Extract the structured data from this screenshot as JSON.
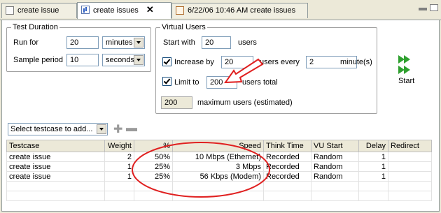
{
  "tabs": [
    {
      "label": "create issue",
      "icon": "testcase-icon"
    },
    {
      "label": "create issues",
      "icon": "schedule-icon",
      "close": "✕"
    },
    {
      "label": "6/22/06 10:46 AM create issues",
      "icon": "report-icon"
    }
  ],
  "test_duration": {
    "legend": "Test Duration",
    "run_for": {
      "label": "Run for",
      "value": "20",
      "unit": "minutes"
    },
    "sample_period": {
      "label": "Sample period",
      "value": "10",
      "unit": "seconds"
    }
  },
  "virtual_users": {
    "legend": "Virtual Users",
    "start_with": {
      "label": "Start with",
      "value": "20",
      "suffix": "users"
    },
    "increase_by": {
      "label": "Increase by",
      "value": "20",
      "middle": "users every",
      "value2": "2",
      "suffix": "minute(s)"
    },
    "limit_to": {
      "label": "Limit to",
      "value": "200",
      "suffix": "users total"
    },
    "max_users": {
      "value": "200",
      "label": "maximum users (estimated)"
    }
  },
  "start_button": {
    "label": "Start"
  },
  "testcase_select": {
    "placeholder": "Select testcase to add..."
  },
  "table": {
    "columns": [
      "Testcase",
      "Weight",
      "%",
      "Speed",
      "Think Time",
      "VU Start",
      "Delay",
      "Redirect"
    ],
    "rows": [
      {
        "testcase": "create issue",
        "weight": "2",
        "pct": "50%",
        "speed": "10 Mbps (Ethernet)",
        "think": "Recorded",
        "vustart": "Random",
        "delay": "1",
        "redirect": ""
      },
      {
        "testcase": "create issue",
        "weight": "1",
        "pct": "25%",
        "speed": "3 Mbps",
        "think": "Recorded",
        "vustart": "Random",
        "delay": "1",
        "redirect": ""
      },
      {
        "testcase": "create issue",
        "weight": "1",
        "pct": "25%",
        "speed": "56 Kbps (Modem)",
        "think": "Recorded",
        "vustart": "Random",
        "delay": "1",
        "redirect": ""
      }
    ]
  },
  "colors": {
    "annotation": "#e02020",
    "start_green": "#2fa02f"
  }
}
